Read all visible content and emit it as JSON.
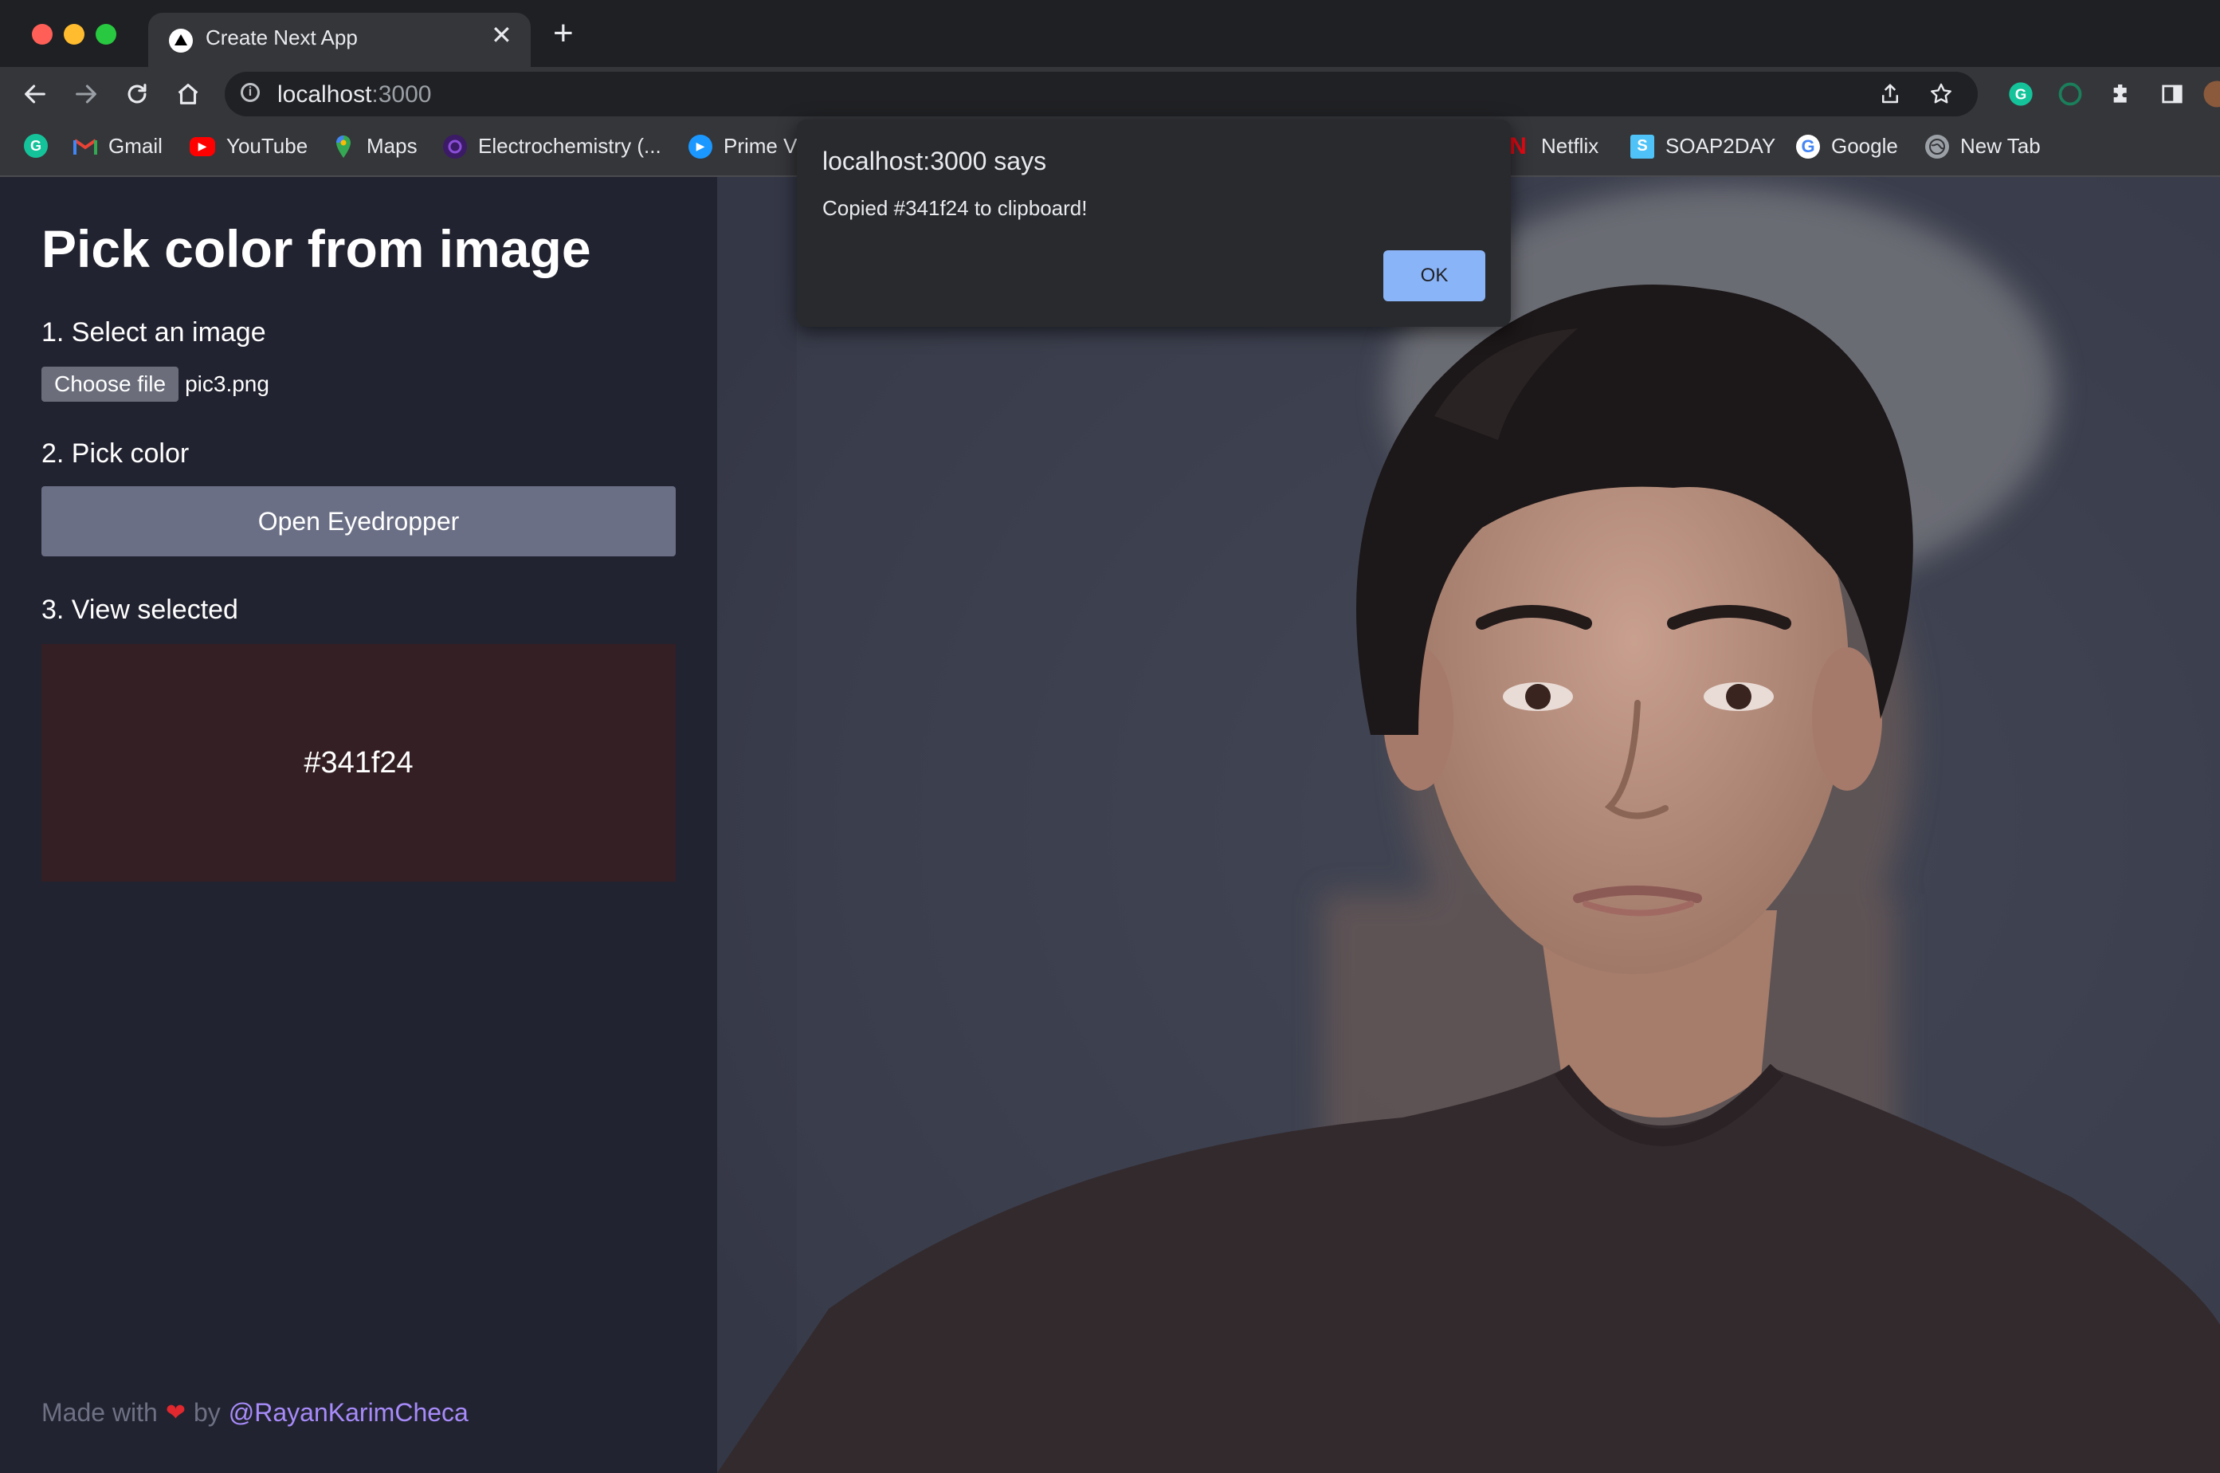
{
  "browser": {
    "tab_title": "Create Next App",
    "tab_close": "✕",
    "new_tab": "+",
    "url_host": "localhost",
    "url_port": ":3000",
    "bookmarks": [
      {
        "label": "",
        "icon": "grammarly-icon",
        "color": "#15c39a"
      },
      {
        "label": "Gmail",
        "icon": "gmail-icon",
        "color": "#ea4335"
      },
      {
        "label": "YouTube",
        "icon": "youtube-icon",
        "color": "#ff0000"
      },
      {
        "label": "Maps",
        "icon": "maps-icon",
        "color": "#34a853"
      },
      {
        "label": "Electrochemistry (...",
        "icon": "electrochemistry-icon",
        "color": "#5b2a86"
      },
      {
        "label": "Prime V",
        "icon": "prime-video-icon",
        "color": "#1a98ff"
      },
      {
        "label": "Netflix",
        "icon": "netflix-icon",
        "color": "#e50914"
      },
      {
        "label": "SOAP2DAY",
        "icon": "soap2day-icon",
        "color": "#4fc3f7"
      },
      {
        "label": "Google",
        "icon": "google-icon",
        "color": "#4285f4"
      },
      {
        "label": "New Tab",
        "icon": "globe-icon",
        "color": "#9aa0a6"
      }
    ]
  },
  "app": {
    "heading": "Pick color from image",
    "step1": "1. Select an image",
    "choose_file": "Choose file",
    "file_name": "pic3.png",
    "step2": "2. Pick color",
    "eyedropper_button": "Open Eyedropper",
    "step3": "3. View selected",
    "selected_color": "#341f24",
    "footer_prefix": "Made with",
    "footer_heart": "❤",
    "footer_by": "by",
    "footer_handle": "@RayanKarimCheca"
  },
  "dialog": {
    "title": "localhost:3000 says",
    "message": "Copied #341f24 to clipboard!",
    "ok_label": "OK"
  },
  "colors": {
    "sidebar_bg": "#222330",
    "image_bg": "#353847",
    "swatch": "#341f24",
    "button": "#6a6f85",
    "dialog_ok": "#8ab4f8",
    "link": "#a78bfa"
  }
}
